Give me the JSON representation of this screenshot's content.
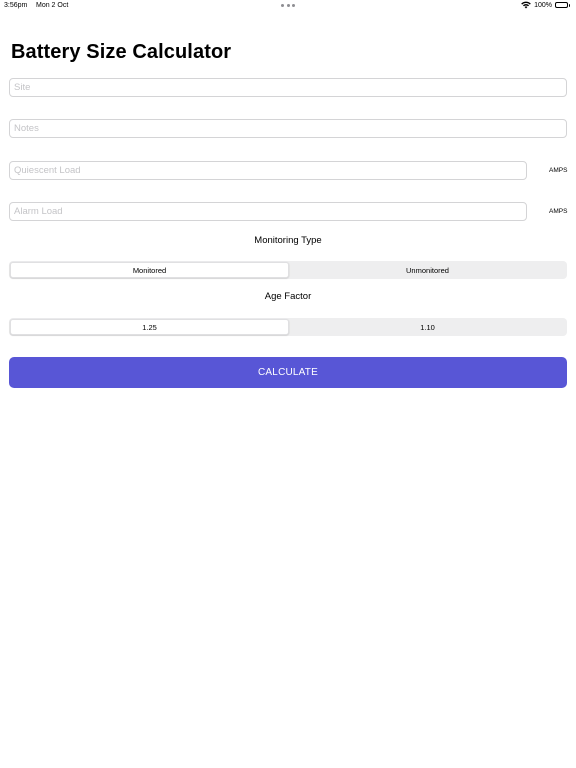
{
  "status_bar": {
    "time": "3:56pm",
    "date": "Mon 2 Oct",
    "battery_percent": "100%",
    "battery_level": 1.0,
    "wifi_icon": "wifi-icon",
    "battery_icon": "battery-icon"
  },
  "page": {
    "title": "Battery Size Calculator"
  },
  "fields": {
    "site": {
      "placeholder": "Site",
      "value": ""
    },
    "notes": {
      "placeholder": "Notes",
      "value": ""
    },
    "quiescent_load": {
      "placeholder": "Quiescent Load",
      "value": "",
      "unit": "AMPS"
    },
    "alarm_load": {
      "placeholder": "Alarm Load",
      "value": "",
      "unit": "AMPS"
    }
  },
  "monitoring_type": {
    "label": "Monitoring Type",
    "options": [
      "Monitored",
      "Unmonitored"
    ],
    "selected": "Monitored"
  },
  "age_factor": {
    "label": "Age Factor",
    "options": [
      "1.25",
      "1.10"
    ],
    "selected": "1.25"
  },
  "actions": {
    "calculate_label": "CALCULATE"
  },
  "colors": {
    "accent": "#5856d6",
    "segment_background": "#eeeeef",
    "field_border": "#d4d4d6",
    "placeholder": "#c4c4c7"
  }
}
